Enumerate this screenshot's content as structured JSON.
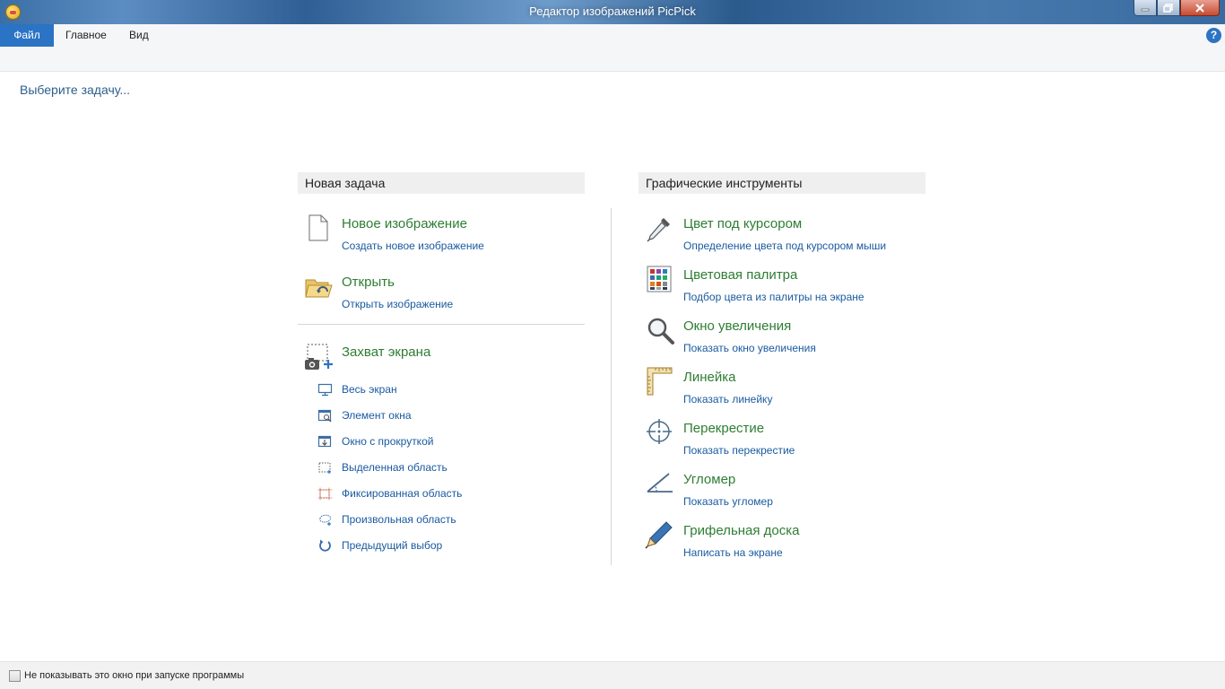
{
  "window": {
    "title": "Редактор изображений PicPick"
  },
  "ribbon": {
    "tabs": [
      {
        "label": "Файл",
        "active": true
      },
      {
        "label": "Главное"
      },
      {
        "label": "Вид"
      }
    ],
    "help_icon": "?"
  },
  "subtitle": "Выберите задачу...",
  "new_task": {
    "heading": "Новая задача",
    "items": [
      {
        "title": "Новое изображение",
        "link": "Создать новое изображение",
        "icon": "new-document-icon"
      },
      {
        "title": "Открыть",
        "link": "Открыть изображение",
        "icon": "open-folder-icon"
      }
    ],
    "capture": {
      "title": "Захват экрана",
      "icon": "screen-capture-icon",
      "options": [
        {
          "label": "Весь экран",
          "icon": "monitor-icon"
        },
        {
          "label": "Элемент окна",
          "icon": "window-control-icon"
        },
        {
          "label": "Окно с прокруткой",
          "icon": "scrolling-window-icon"
        },
        {
          "label": "Выделенная область",
          "icon": "region-icon"
        },
        {
          "label": "Фиксированная область",
          "icon": "fixed-region-icon"
        },
        {
          "label": "Произвольная область",
          "icon": "freehand-icon"
        },
        {
          "label": "Предыдущий выбор",
          "icon": "repeat-icon"
        }
      ]
    }
  },
  "graphic_tools": {
    "heading": "Графические инструменты",
    "items": [
      {
        "title": "Цвет под курсором",
        "link": "Определение цвета под курсором мыши",
        "icon": "eyedropper-icon"
      },
      {
        "title": "Цветовая палитра",
        "link": "Подбор цвета из палитры на экране",
        "icon": "palette-icon"
      },
      {
        "title": "Окно увеличения",
        "link": "Показать окно увеличения",
        "icon": "magnifier-icon"
      },
      {
        "title": "Линейка",
        "link": "Показать линейку",
        "icon": "ruler-icon"
      },
      {
        "title": "Перекрестие",
        "link": "Показать перекрестие",
        "icon": "crosshair-icon"
      },
      {
        "title": "Угломер",
        "link": "Показать угломер",
        "icon": "protractor-icon"
      },
      {
        "title": "Грифельная доска",
        "link": "Написать на экране",
        "icon": "pen-icon"
      }
    ]
  },
  "footer": {
    "checkbox_label": "Не показывать это окно при запуске программы",
    "checked": false
  },
  "colors": {
    "accent": "#2b73c4",
    "title_green": "#2e7d32",
    "link_blue": "#1a5aa0"
  }
}
